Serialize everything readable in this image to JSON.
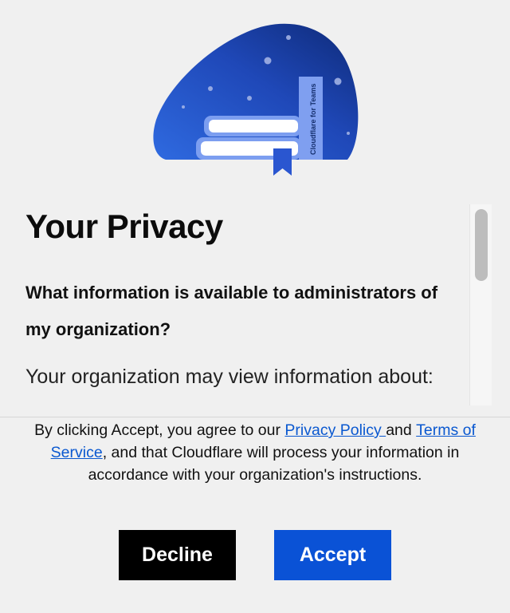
{
  "illustration": {
    "bookmark_label": "Cloudflare for Teams"
  },
  "privacy": {
    "title": "Your Privacy",
    "question": "What information is available to administrators of my organization?",
    "answer": "Your organization may view information about:"
  },
  "consent": {
    "prefix": "By clicking Accept, you agree to our ",
    "privacy_link": "Privacy Policy ",
    "and": "and",
    "terms_link": "Terms of Service",
    "suffix": ", and that Cloudflare will process your information in accordance with your organization's instructions."
  },
  "buttons": {
    "decline": "Decline",
    "accept": "Accept"
  },
  "colors": {
    "accept": "#0a52d6",
    "decline": "#000000",
    "link": "#0a58d0",
    "illustration_dark": "#0e2a78",
    "illustration_light": "#2f6ae0"
  }
}
